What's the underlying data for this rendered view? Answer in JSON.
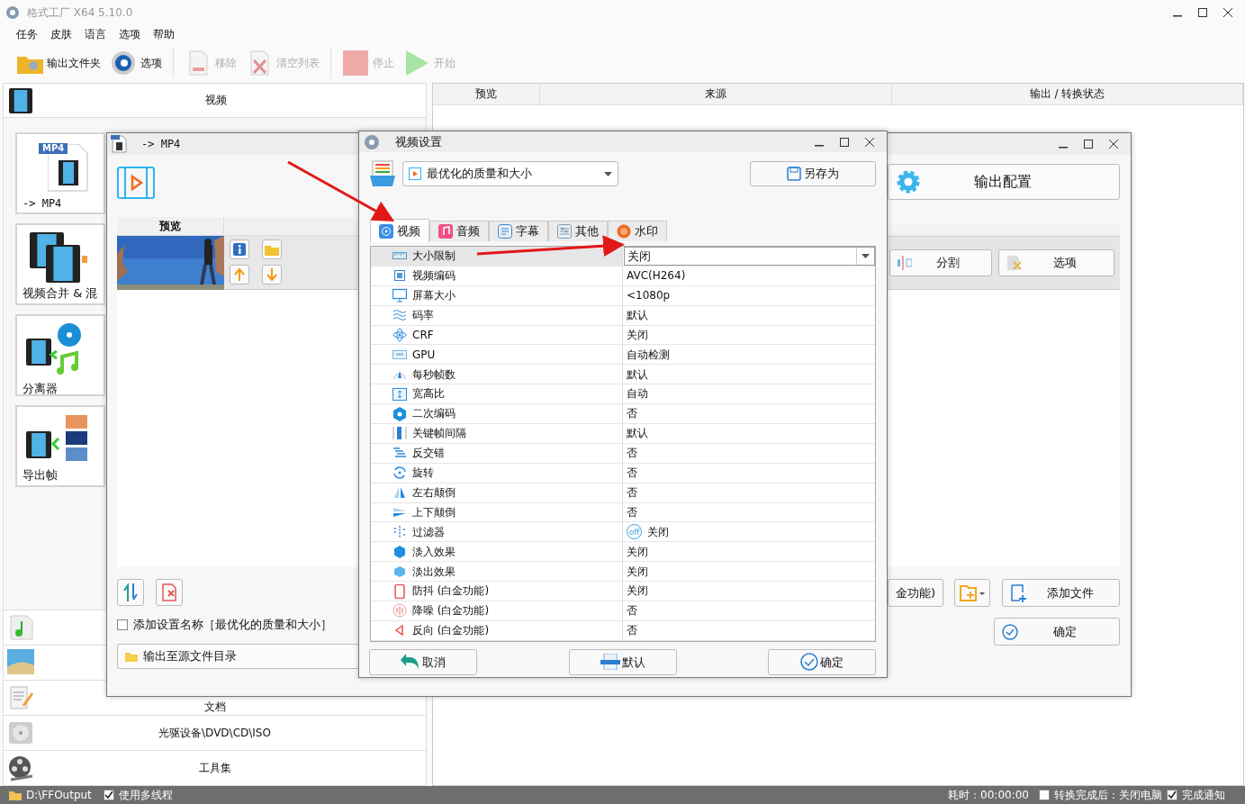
{
  "window": {
    "title": "格式工厂 X64 5.10.0"
  },
  "menu": [
    "任务",
    "皮肤",
    "语言",
    "选项",
    "帮助"
  ],
  "toolbar": [
    {
      "label": "输出文件夹",
      "kind": "folder",
      "disabled": false
    },
    {
      "label": "选项",
      "kind": "gear",
      "disabled": false
    },
    {
      "label": "移除",
      "kind": "remove",
      "disabled": true
    },
    {
      "label": "清空列表",
      "kind": "clear",
      "disabled": true
    },
    {
      "label": "停止",
      "kind": "stop",
      "disabled": true
    },
    {
      "label": "开始",
      "kind": "start",
      "disabled": true
    }
  ],
  "category": {
    "label": "视频"
  },
  "video_tools": [
    {
      "label": "-> MP4",
      "badge": "MP4",
      "kind": "mp4"
    },
    {
      "label": "视频合并 & 混",
      "kind": "merge"
    },
    {
      "label": "分离器",
      "kind": "splitter"
    },
    {
      "label": "导出帧",
      "kind": "frames"
    }
  ],
  "other_categories": [
    {
      "kind": "audio"
    },
    {
      "kind": "picture"
    },
    {
      "kind": "document",
      "label": "文档"
    },
    {
      "kind": "disc",
      "label": "光驱设备\\DVD\\CD\\ISO"
    },
    {
      "kind": "tools",
      "label": "工具集"
    }
  ],
  "task_table": {
    "columns": [
      "预览",
      "来源",
      "输出 / 转换状态"
    ]
  },
  "status_bar": {
    "output_folder": "D:\\FFOutput",
    "multithread": {
      "label": "使用多线程",
      "checked": true
    },
    "elapsed": "耗时：00:00:00",
    "shutdown": {
      "label": "转换完成后：关闭电脑",
      "checked": false
    },
    "notify": {
      "label": "完成通知",
      "checked": true
    }
  },
  "convert_window": {
    "title": "-> MP4",
    "list_header": "预览",
    "output_config": "输出配置",
    "item_tools": [
      "分割",
      "选项"
    ],
    "platinum_button": "金功能)",
    "add_file": "添加文件",
    "add_name": {
      "label": "添加设置名称［最优化的质量和大小］",
      "checked": false
    },
    "output_dir": "输出至源文件目录",
    "ok": "确定"
  },
  "settings_dialog": {
    "title": "视频设置",
    "preset": "最优化的质量和大小",
    "save_as": "另存为",
    "tabs": [
      {
        "label": "视频",
        "kind": "video",
        "selected": true
      },
      {
        "label": "音频",
        "kind": "audio",
        "selected": false
      },
      {
        "label": "字幕",
        "kind": "subtitle",
        "selected": false
      },
      {
        "label": "其他",
        "kind": "other",
        "selected": false
      },
      {
        "label": "水印",
        "kind": "watermark",
        "selected": false
      }
    ],
    "properties": [
      {
        "name": "大小限制",
        "value": "关闭",
        "kind": "ruler",
        "selected": true
      },
      {
        "name": "视频编码",
        "value": "AVC(H264)",
        "kind": "chip",
        "selected": false
      },
      {
        "name": "屏幕大小",
        "value": "<1080p",
        "kind": "monitor",
        "selected": false
      },
      {
        "name": "码率",
        "value": "默认",
        "kind": "waves",
        "selected": false
      },
      {
        "name": "CRF",
        "value": "关闭",
        "kind": "atom",
        "selected": false
      },
      {
        "name": "GPU",
        "value": "自动检测",
        "kind": "gpu",
        "selected": false
      },
      {
        "name": "每秒帧数",
        "value": "默认",
        "kind": "speed",
        "selected": false
      },
      {
        "name": "宽高比",
        "value": "自动",
        "kind": "aspect",
        "selected": false
      },
      {
        "name": "二次编码",
        "value": "否",
        "kind": "hexnum",
        "selected": false
      },
      {
        "name": "关键帧间隔",
        "value": "默认",
        "kind": "bars",
        "selected": false
      },
      {
        "name": "反交错",
        "value": "否",
        "kind": "lines",
        "selected": false
      },
      {
        "name": "旋转",
        "value": "否",
        "kind": "rotate",
        "selected": false
      },
      {
        "name": "左右颠倒",
        "value": "否",
        "kind": "mirror-h",
        "selected": false
      },
      {
        "name": "上下颠倒",
        "value": "否",
        "kind": "mirror-v",
        "selected": false
      },
      {
        "name": "过滤器",
        "value": "关闭",
        "badge": "off",
        "kind": "filter",
        "selected": false
      },
      {
        "name": "淡入效果",
        "value": "关闭",
        "kind": "hex-dark",
        "selected": false
      },
      {
        "name": "淡出效果",
        "value": "关闭",
        "kind": "hex-light",
        "selected": false
      },
      {
        "name": "防抖 (白金功能)",
        "value": "关闭",
        "kind": "phone",
        "selected": false
      },
      {
        "name": "降噪 (白金功能)",
        "value": "否",
        "kind": "noise",
        "selected": false
      },
      {
        "name": "反向 (白金功能)",
        "value": "否",
        "kind": "reverse",
        "selected": false
      }
    ],
    "buttons": [
      {
        "label": "取消",
        "kind": "cancel"
      },
      {
        "label": "默认",
        "kind": "default"
      },
      {
        "label": "确定",
        "kind": "ok"
      }
    ]
  },
  "annotations": [
    {
      "kind": "arrow"
    },
    {
      "kind": "arrow"
    }
  ]
}
